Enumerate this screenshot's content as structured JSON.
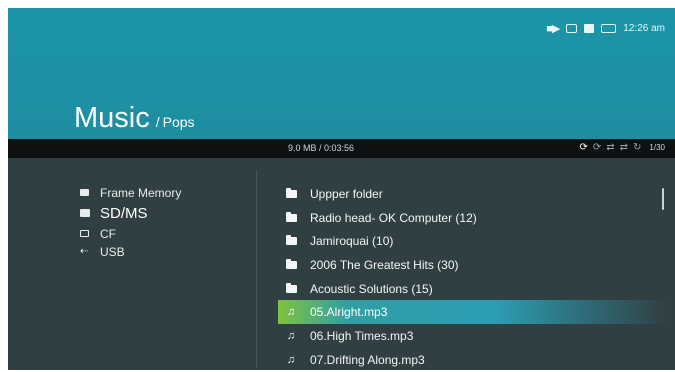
{
  "status_bar": {
    "time": "12:26 am",
    "icons": [
      "memory-card-status-icon",
      "usb-status-icon",
      "sd-card-status-icon",
      "battery-icon"
    ]
  },
  "title": {
    "main": "Music",
    "separator": "/",
    "sub": "Pops"
  },
  "info_bar": {
    "file_info": "9.0 MB / 0:03:56",
    "track_count": "1/30",
    "mode_icons": [
      "repeat-all-icon",
      "repeat-one-icon",
      "shuffle-icon",
      "shuffle-repeat-icon",
      "repeat-off-icon"
    ]
  },
  "sources": [
    {
      "label": "Frame Memory",
      "icon": "frame-memory-icon",
      "selected": false
    },
    {
      "label": "SD/MS",
      "icon": "sd-card-icon",
      "selected": true
    },
    {
      "label": "CF",
      "icon": "cf-card-icon",
      "selected": false
    },
    {
      "label": "USB",
      "icon": "usb-icon",
      "selected": false
    }
  ],
  "files": [
    {
      "label": "Uppper folder",
      "icon": "upper-folder-icon"
    },
    {
      "label": "Radio head- OK Computer (12)",
      "icon": "folder-icon"
    },
    {
      "label": "Jamiroquai (10)",
      "icon": "folder-icon"
    },
    {
      "label": "2006 The Greatest Hits (30)",
      "icon": "folder-icon"
    },
    {
      "label": "Acoustic Solutions (15)",
      "icon": "folder-icon"
    },
    {
      "label": "05.Alright.mp3",
      "icon": "music-note-icon",
      "highlighted": true
    },
    {
      "label": "06.High Times.mp3",
      "icon": "music-note-icon"
    },
    {
      "label": "07.Drifting Along.mp3",
      "icon": "music-note-icon"
    }
  ],
  "colors": {
    "header": "#1e8ea1",
    "panel": "#303f41",
    "info_bar": "#0f1012",
    "highlight_start": "#7fc240",
    "highlight_end": "#2c9eb4"
  }
}
